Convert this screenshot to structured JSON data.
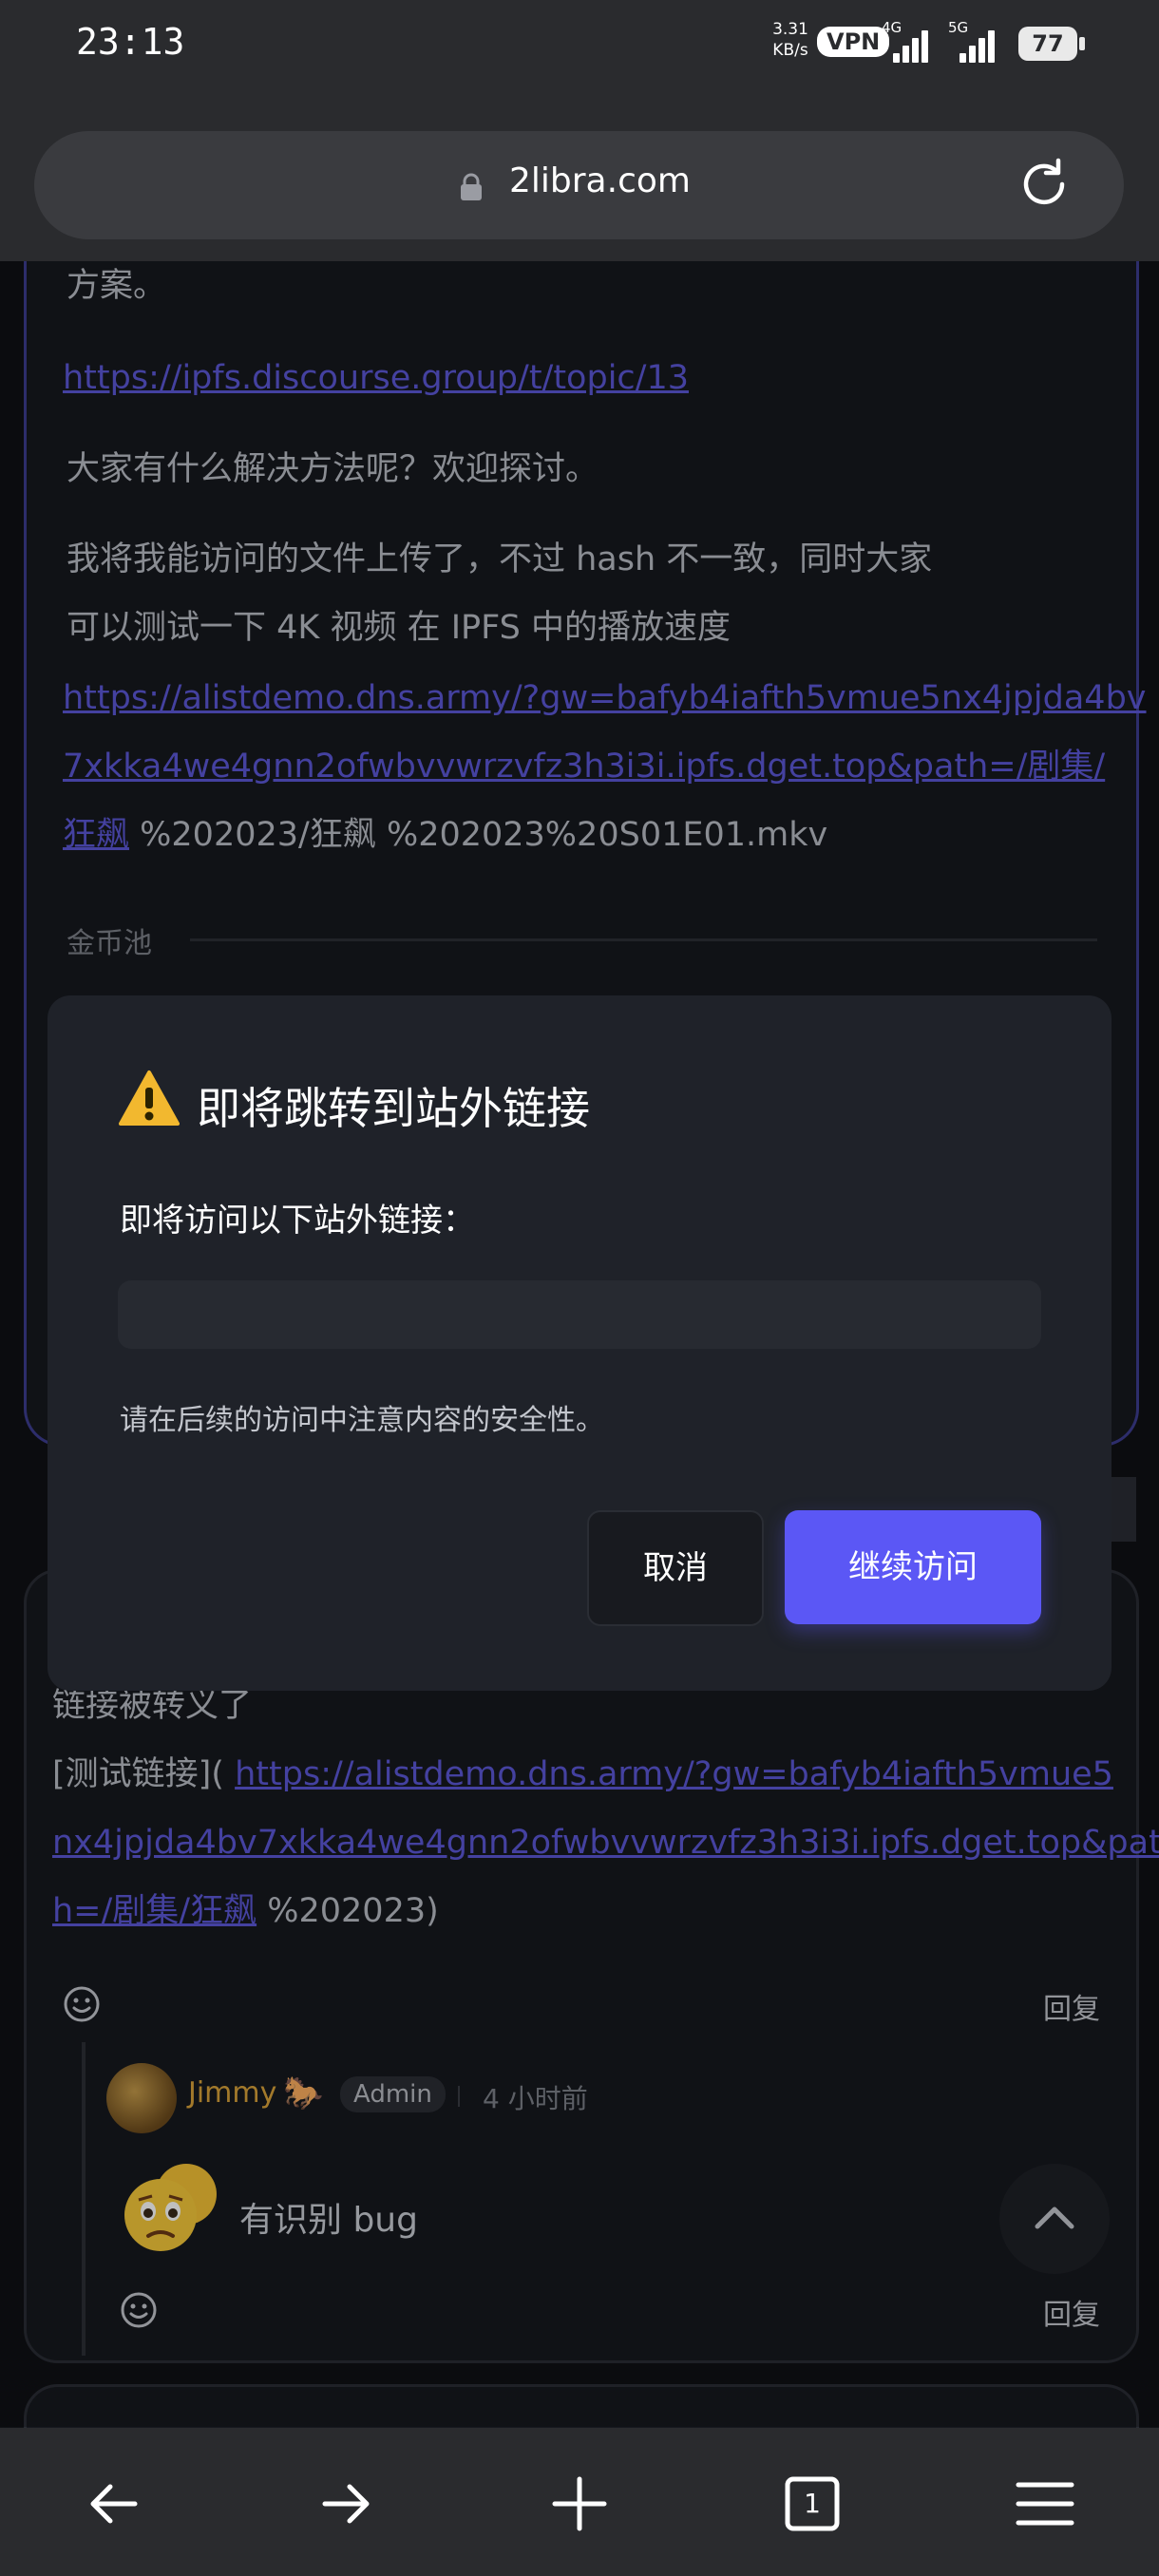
{
  "status_bar": {
    "time": "23:13",
    "net_speed_value": "3.31",
    "net_speed_unit": "KB/s",
    "vpn": "VPN",
    "sim1": "4G",
    "sim2": "5G",
    "battery": "77"
  },
  "browser": {
    "url": "2libra.com"
  },
  "post": {
    "line_1": "方案。",
    "link_1": "https://ipfs.discourse.group/t/topic/13",
    "line_2": "大家有什么解决方法呢？欢迎探讨。",
    "line_3a": "我将我能访问的文件上传了，不过 hash 不一致，同时大家",
    "line_3b": "可以测试一下 4K 视频 在 IPFS 中的播放速度",
    "link_2a": "https://alistdemo.dns.army/?gw=bafyb4iafth5vmue5nx4jpjda4bv",
    "link_2b": "7xkka4we4gnn2ofwbvvwrzvfz3h3i3i.ipfs.dget.top&path=/剧集/",
    "link_2c": "狂飙",
    "link_2_tail": "%202023/狂飙 %202023%20S01E01.mkv",
    "coin_pool": "金币池"
  },
  "comment": {
    "line_1": "链接被转义了",
    "line_2_prefix": "[测试链接](",
    "link_a": "https://alistdemo.dns.army/?gw=bafyb4iafth5vmue5",
    "link_b": "nx4jpjda4bv7xkka4we4gnn2ofwbvvwrzvfz3h3i3i.ipfs.dget.top&pat",
    "link_c": "h=/剧集/狂飙",
    "tail": "%202023)",
    "reply_label": "回复"
  },
  "reply": {
    "author": "Jimmy",
    "badge": "Admin",
    "time_ago": "4 小时前",
    "text": "有识别 bug",
    "reply_label": "回复"
  },
  "dialog": {
    "title": "即将跳转到站外链接",
    "subtitle": "即将访问以下站外链接：",
    "url_value": "",
    "note": "请在后续的访问中注意内容的安全性。",
    "cancel": "取消",
    "continue": "继续访问"
  },
  "icons": {
    "lock": "lock-icon",
    "reload": "reload-icon",
    "warning": "warning-icon",
    "smile": "smile-icon",
    "scroll_top": "chevron-up-icon",
    "back": "back-arrow-icon",
    "forward": "forward-arrow-icon",
    "new_tab": "plus-icon",
    "tabs": "tabs-icon",
    "menu": "menu-icon"
  },
  "colors": {
    "accent": "#5b57f5",
    "link": "#5b57d6",
    "author": "#d9a23a"
  },
  "tabs_count": "1"
}
